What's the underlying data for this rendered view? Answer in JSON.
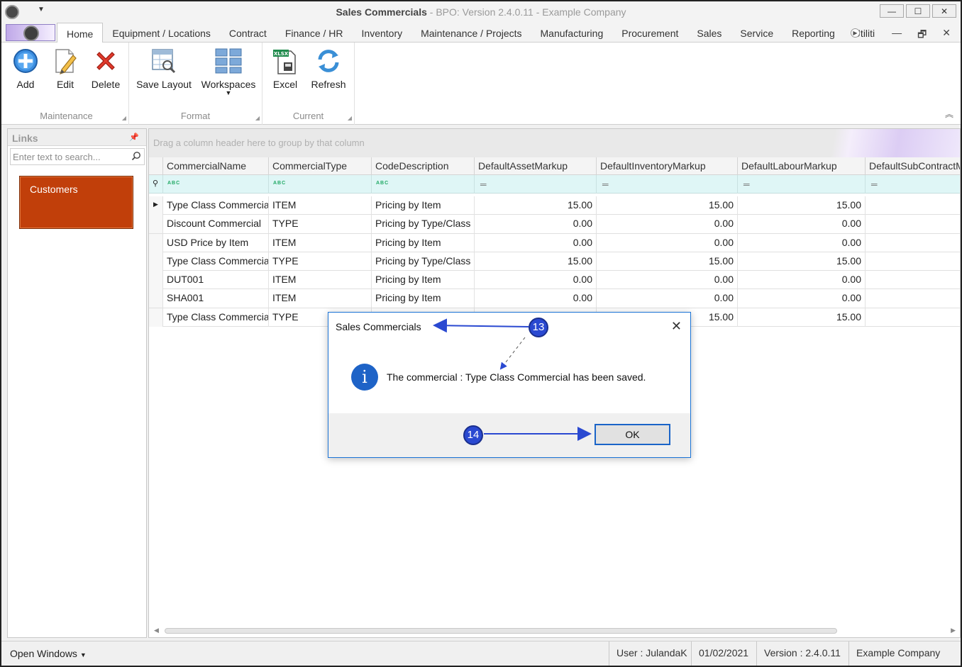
{
  "window": {
    "title_main": "Sales Commercials",
    "title_suffix": " - BPO: Version 2.4.0.11 - Example Company",
    "minimize": "—",
    "maximize": "☐",
    "close": "✕"
  },
  "menu": {
    "tabs": [
      "Home",
      "Equipment / Locations",
      "Contract",
      "Finance / HR",
      "Inventory",
      "Maintenance / Projects",
      "Manufacturing",
      "Procurement",
      "Sales",
      "Service",
      "Reporting",
      "Utiliti"
    ],
    "mdi_minimize": "—",
    "mdi_restore": "🗗",
    "mdi_close": "✕"
  },
  "ribbon": {
    "groups": {
      "maintenance": "Maintenance",
      "format": "Format",
      "current": "Current"
    },
    "buttons": {
      "add": "Add",
      "edit": "Edit",
      "delete": "Delete",
      "save_layout": "Save Layout",
      "workspaces": "Workspaces",
      "excel": "Excel",
      "refresh": "Refresh"
    }
  },
  "links": {
    "title": "Links",
    "search_placeholder": "Enter text to search...",
    "tiles": [
      "Customers"
    ]
  },
  "grid": {
    "group_hint": "Drag a column header here to group by that column",
    "columns": [
      "CommercialName",
      "CommercialType",
      "CodeDescription",
      "DefaultAssetMarkup",
      "DefaultInventoryMarkup",
      "DefaultLabourMarkup",
      "DefaultSubContractM"
    ],
    "rows": [
      [
        "Type Class Commercial",
        "ITEM",
        "Pricing by Item",
        "15.00",
        "15.00",
        "15.00",
        ""
      ],
      [
        "Discount Commercial",
        "TYPE",
        "Pricing by Type/Class",
        "0.00",
        "0.00",
        "0.00",
        ""
      ],
      [
        "USD Price by Item",
        "ITEM",
        "Pricing by Item",
        "0.00",
        "0.00",
        "0.00",
        ""
      ],
      [
        "Type Class Commercial",
        "TYPE",
        "Pricing by Type/Class",
        "15.00",
        "15.00",
        "15.00",
        ""
      ],
      [
        "DUT001",
        "ITEM",
        "Pricing by Item",
        "0.00",
        "0.00",
        "0.00",
        ""
      ],
      [
        "SHA001",
        "ITEM",
        "Pricing by Item",
        "0.00",
        "0.00",
        "0.00",
        ""
      ],
      [
        "Type Class Commercial",
        "TYPE",
        "",
        "",
        "15.00",
        "15.00",
        ""
      ]
    ]
  },
  "status": {
    "open_windows": "Open Windows",
    "user": "User : JulandaK",
    "date": "01/02/2021",
    "version": "Version : 2.4.0.11",
    "company": "Example Company"
  },
  "dialog": {
    "title": "Sales Commercials",
    "message": "The commercial : Type Class Commercial has been saved.",
    "ok": "OK",
    "close": "✕"
  },
  "callouts": {
    "title_callout": "13",
    "ok_callout": "14"
  },
  "colors": {
    "accent": "#1a73d6",
    "tile": "#c13f0a",
    "callout": "#2a49d1",
    "filter_row": "#dff6f6"
  }
}
